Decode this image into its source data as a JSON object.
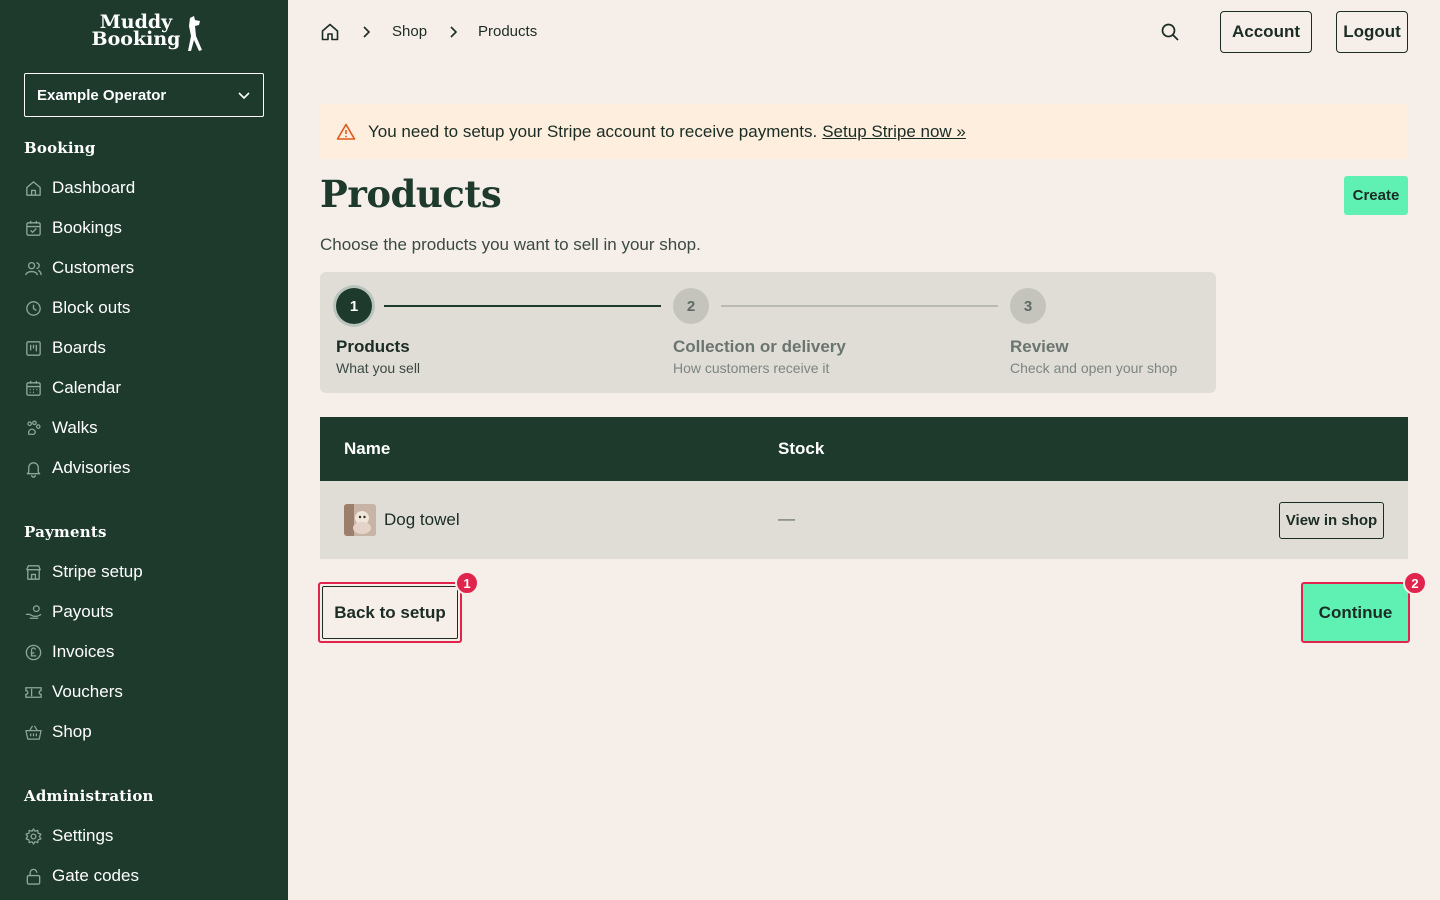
{
  "brand": {
    "line1": "Muddy",
    "line2": "Booking"
  },
  "operator": {
    "selected": "Example Operator"
  },
  "sidebar": {
    "sections": [
      {
        "title": "Booking",
        "items": [
          {
            "label": "Dashboard",
            "icon": "home-icon"
          },
          {
            "label": "Bookings",
            "icon": "calendar-check-icon"
          },
          {
            "label": "Customers",
            "icon": "users-icon"
          },
          {
            "label": "Block outs",
            "icon": "clock-icon"
          },
          {
            "label": "Boards",
            "icon": "board-icon"
          },
          {
            "label": "Calendar",
            "icon": "calendar-icon"
          },
          {
            "label": "Walks",
            "icon": "paw-icon"
          },
          {
            "label": "Advisories",
            "icon": "bell-icon"
          }
        ]
      },
      {
        "title": "Payments",
        "items": [
          {
            "label": "Stripe setup",
            "icon": "store-icon"
          },
          {
            "label": "Payouts",
            "icon": "hand-coins-icon"
          },
          {
            "label": "Invoices",
            "icon": "pound-icon"
          },
          {
            "label": "Vouchers",
            "icon": "ticket-icon"
          },
          {
            "label": "Shop",
            "icon": "basket-icon"
          }
        ]
      },
      {
        "title": "Administration",
        "items": [
          {
            "label": "Settings",
            "icon": "gear-icon"
          },
          {
            "label": "Gate codes",
            "icon": "lock-icon"
          }
        ]
      }
    ]
  },
  "breadcrumb": {
    "items": [
      "Shop",
      "Products"
    ]
  },
  "header": {
    "account_label": "Account",
    "logout_label": "Logout"
  },
  "alert": {
    "message": "You need to setup your Stripe account to receive payments.",
    "link": "Setup Stripe now »"
  },
  "page": {
    "title": "Products",
    "create_label": "Create",
    "subtitle": "Choose the products you want to sell in your shop."
  },
  "steps": [
    {
      "number": "1",
      "title": "Products",
      "desc": "What you sell",
      "state": "active"
    },
    {
      "number": "2",
      "title": "Collection or delivery",
      "desc": "How customers receive it",
      "state": "inactive"
    },
    {
      "number": "3",
      "title": "Review",
      "desc": "Check and open your shop",
      "state": "inactive"
    }
  ],
  "table": {
    "columns": [
      "Name",
      "Stock"
    ],
    "rows": [
      {
        "name": "Dog towel",
        "stock": "—",
        "action": "View in shop"
      }
    ]
  },
  "footer": {
    "back_label": "Back to setup",
    "back_badge": "1",
    "continue_label": "Continue",
    "continue_badge": "2"
  },
  "colors": {
    "sidebar": "#1e3a2d",
    "background": "#f6efe9",
    "accent": "#5ff0b4",
    "alert_bg": "#fdeedd",
    "highlight": "#e0244c"
  }
}
